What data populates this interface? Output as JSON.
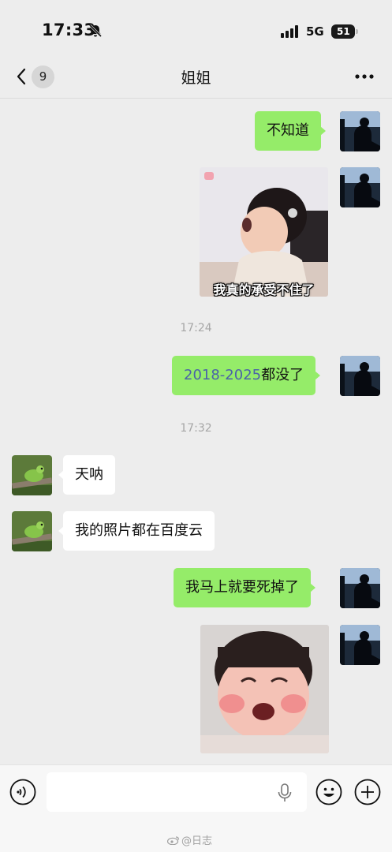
{
  "status_bar": {
    "time": "17:33",
    "network": "5G",
    "battery": "51"
  },
  "nav": {
    "unread_count": "9",
    "title": "姐姐"
  },
  "messages": [
    {
      "from": "me",
      "type": "text",
      "text": "不知道"
    },
    {
      "from": "me",
      "type": "sticker",
      "caption": "我真的承受不住了"
    },
    {
      "type": "time",
      "text": "17:24"
    },
    {
      "from": "me",
      "type": "text",
      "years": "2018-2025",
      "text": "都没了"
    },
    {
      "type": "time",
      "text": "17:32"
    },
    {
      "from": "other",
      "type": "text",
      "text": "天呐"
    },
    {
      "from": "other",
      "type": "text",
      "text": "我的照片都在百度云"
    },
    {
      "from": "me",
      "type": "text",
      "text": "我马上就要死掉了"
    },
    {
      "from": "me",
      "type": "sticker",
      "caption": ""
    }
  ],
  "input_bar": {
    "placeholder": ""
  },
  "watermark": "@日志",
  "colors": {
    "background": "#ededed",
    "my_bubble": "#95ec69",
    "their_bubble": "#ffffff",
    "year_text": "#4b63a8"
  }
}
